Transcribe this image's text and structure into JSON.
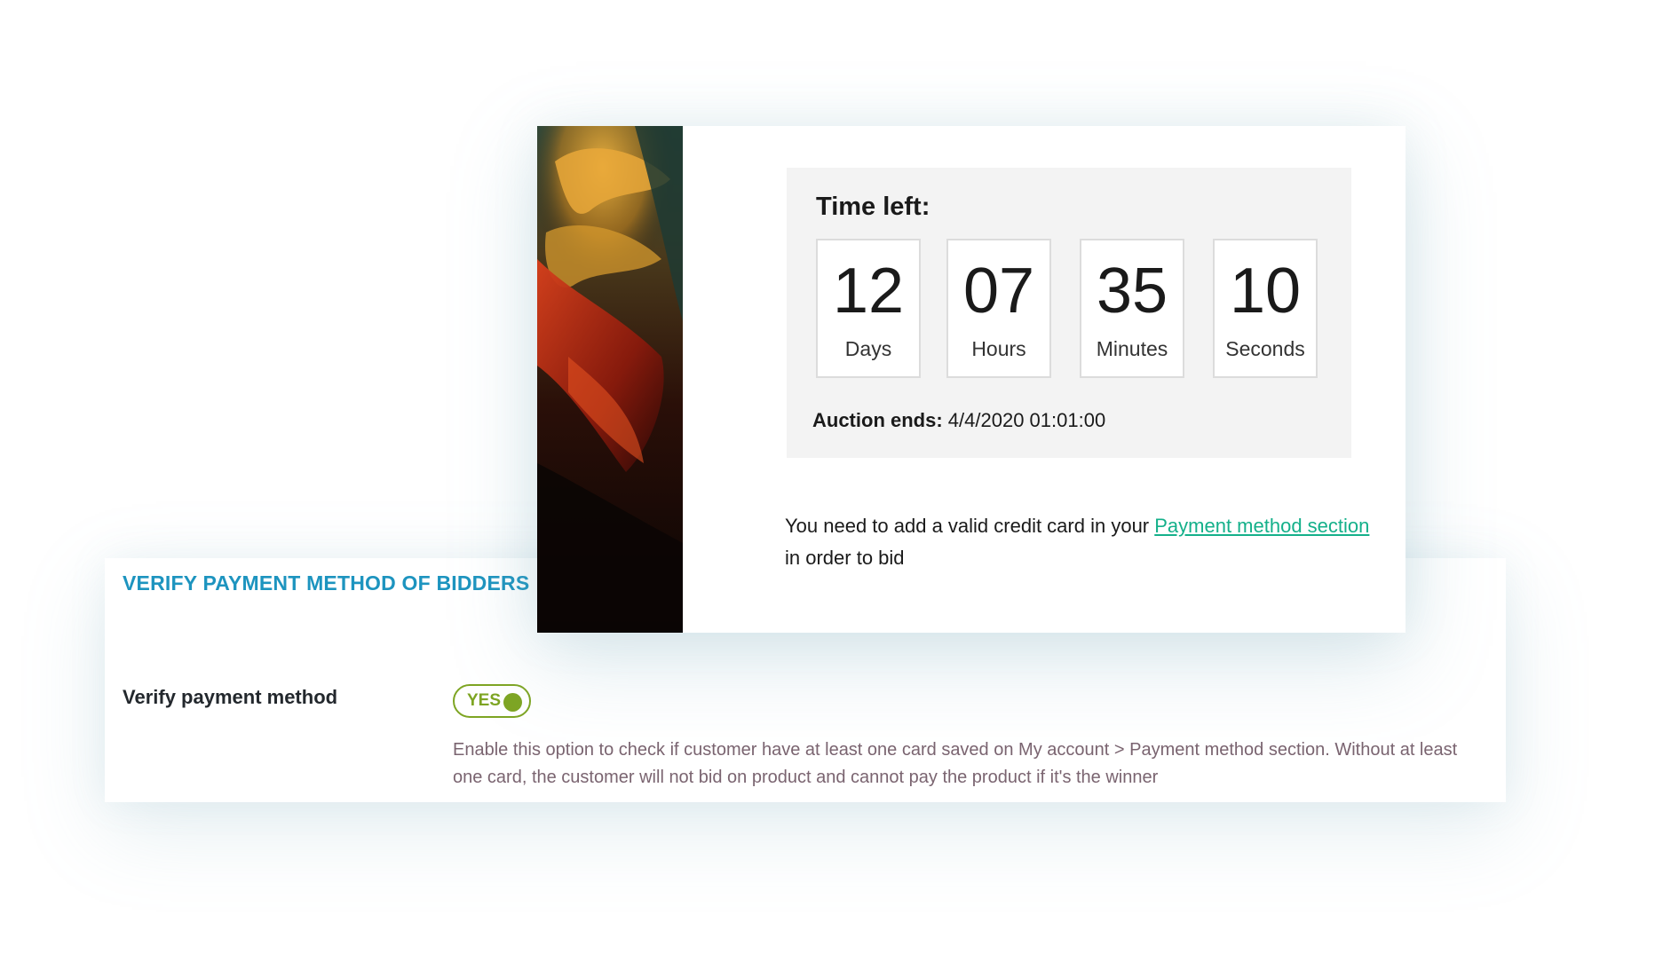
{
  "settings": {
    "section_title": "VERIFY PAYMENT METHOD OF BIDDERS",
    "field_label": "Verify payment method",
    "toggle_label": "YES",
    "toggle_state": "on",
    "description": "Enable this option to check if customer have at least one card saved on My account > Payment method section. Without at least one card, the customer will not bid on product and cannot pay the product if it's the winner"
  },
  "auction": {
    "title": "Time left:",
    "countdown": [
      {
        "value": "12",
        "unit": "Days"
      },
      {
        "value": "07",
        "unit": "Hours"
      },
      {
        "value": "35",
        "unit": "Minutes"
      },
      {
        "value": "10",
        "unit": "Seconds"
      }
    ],
    "ends_label": "Auction ends:",
    "ends_value": "4/4/2020 01:01:00",
    "notice_prefix": "You need to add a valid credit card in your ",
    "notice_link": "Payment method section",
    "notice_suffix": " in order to bid"
  },
  "colors": {
    "section_title": "#1d94bf",
    "toggle_accent": "#7ea523",
    "link": "#14b08a",
    "description_text": "#7a6470",
    "countdown_background": "#f3f3f3"
  }
}
